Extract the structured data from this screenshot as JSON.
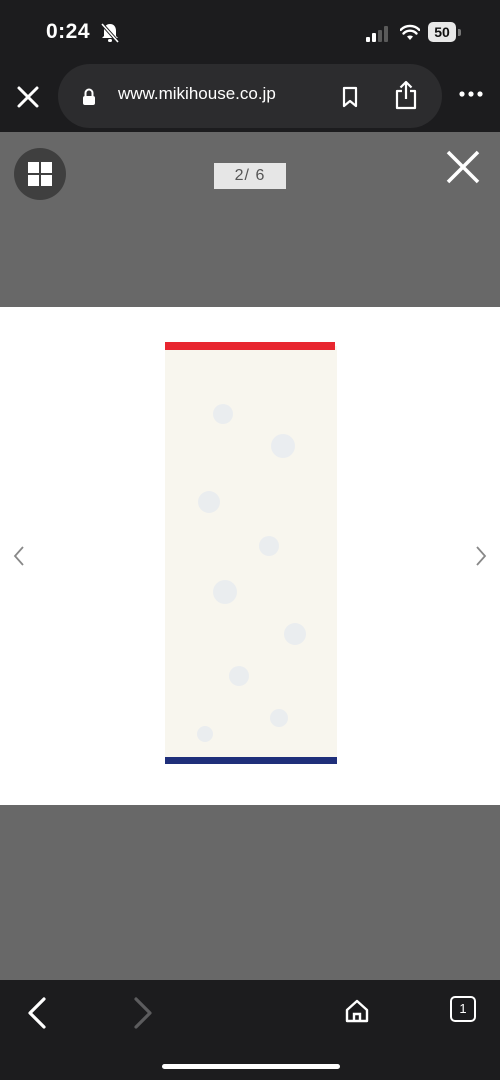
{
  "status_bar": {
    "time": "0:24",
    "battery": "50"
  },
  "browser": {
    "url": "www.mikihouse.co.jp"
  },
  "gallery": {
    "counter": "2/  6",
    "towel_top_stripe_color": "#e8262f",
    "towel_bottom_stripe_color": "#1f2f7a"
  },
  "tabs": {
    "count": "1"
  },
  "icons": [
    "bell-slash-icon",
    "signal-icon",
    "wifi-icon",
    "close-icon",
    "lock-icon",
    "bookmark-icon",
    "share-icon",
    "more-icon",
    "grid-icon",
    "chevron-left-icon",
    "chevron-right-icon",
    "back-icon",
    "forward-icon",
    "home-icon",
    "tabs-icon"
  ]
}
